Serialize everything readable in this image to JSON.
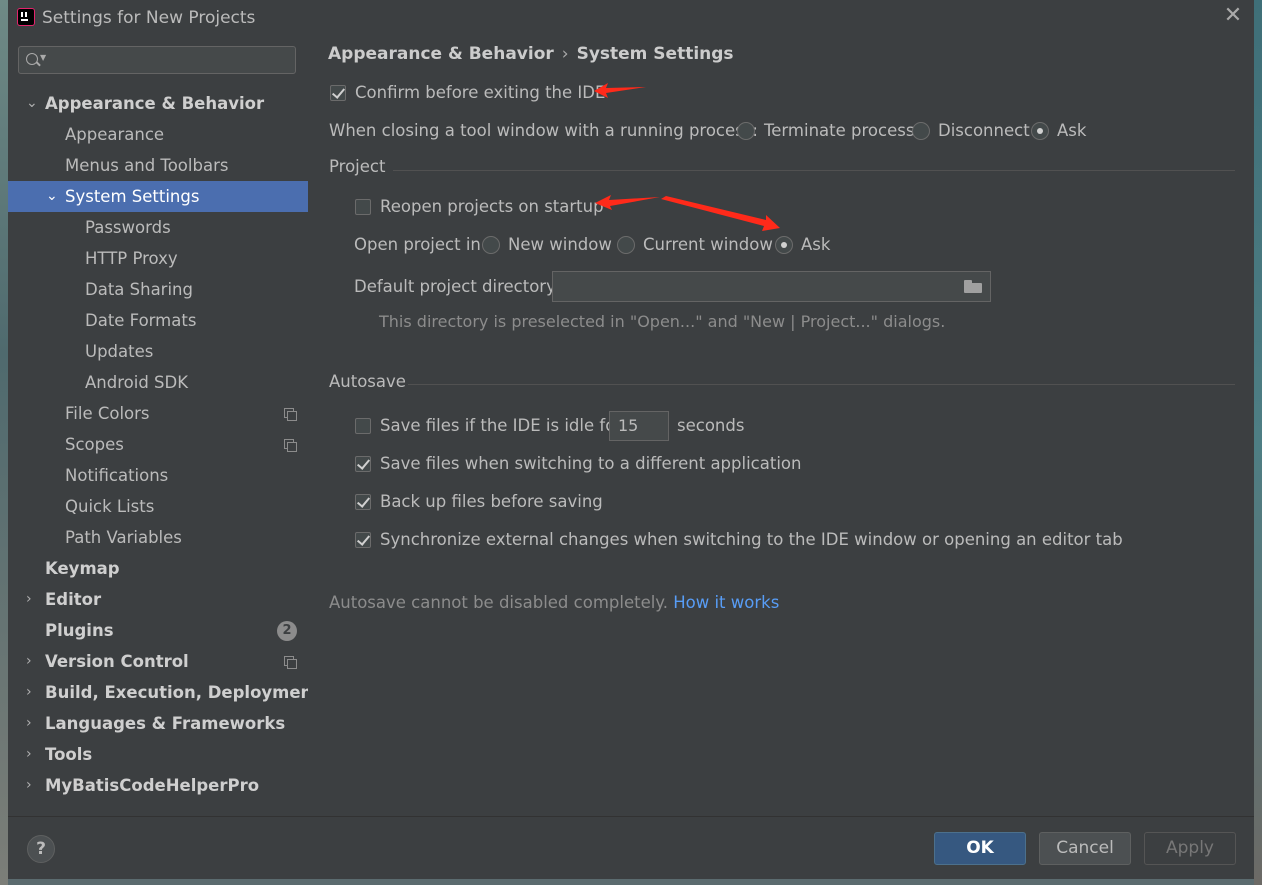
{
  "window": {
    "title": "Settings for New Projects"
  },
  "search": {
    "placeholder": ""
  },
  "sidebar": {
    "items": [
      {
        "label": "Appearance & Behavior"
      },
      {
        "label": "Appearance"
      },
      {
        "label": "Menus and Toolbars"
      },
      {
        "label": "System Settings"
      },
      {
        "label": "Passwords"
      },
      {
        "label": "HTTP Proxy"
      },
      {
        "label": "Data Sharing"
      },
      {
        "label": "Date Formats"
      },
      {
        "label": "Updates"
      },
      {
        "label": "Android SDK"
      },
      {
        "label": "File Colors"
      },
      {
        "label": "Scopes"
      },
      {
        "label": "Notifications"
      },
      {
        "label": "Quick Lists"
      },
      {
        "label": "Path Variables"
      },
      {
        "label": "Keymap"
      },
      {
        "label": "Editor"
      },
      {
        "label": "Plugins",
        "badge": "2"
      },
      {
        "label": "Version Control"
      },
      {
        "label": "Build, Execution, Deployment"
      },
      {
        "label": "Languages & Frameworks"
      },
      {
        "label": "Tools"
      },
      {
        "label": "MyBatisCodeHelperPro"
      }
    ]
  },
  "breadcrumb": {
    "parent": "Appearance & Behavior",
    "sep": "›",
    "current": "System Settings"
  },
  "general": {
    "confirm_exit": {
      "label": "Confirm before exiting the IDE",
      "checked": true
    },
    "closing_tool_window": {
      "label": "When closing a tool window with a running process:",
      "options": [
        "Terminate process",
        "Disconnect",
        "Ask"
      ],
      "selected": "Ask"
    }
  },
  "project": {
    "title": "Project",
    "reopen": {
      "label": "Reopen projects on startup",
      "checked": false
    },
    "open_in": {
      "label": "Open project in",
      "options": [
        "New window",
        "Current window",
        "Ask"
      ],
      "selected": "Ask"
    },
    "default_dir": {
      "label": "Default project directory:",
      "value": ""
    },
    "hint": "This directory is preselected in \"Open...\" and \"New | Project...\" dialogs."
  },
  "autosave": {
    "title": "Autosave",
    "idle": {
      "label": "Save files if the IDE is idle for",
      "value": "15",
      "unit": "seconds",
      "checked": false
    },
    "switching": {
      "label": "Save files when switching to a different application",
      "checked": true
    },
    "backup": {
      "label": "Back up files before saving",
      "checked": true
    },
    "sync": {
      "label": "Synchronize external changes when switching to the IDE window or opening an editor tab",
      "checked": true
    },
    "note": "Autosave cannot be disabled completely.",
    "link": "How it works"
  },
  "footer": {
    "help": "?",
    "ok": "OK",
    "cancel": "Cancel",
    "apply": "Apply"
  },
  "colors": {
    "accent": "#4b6eaf",
    "ok_button": "#365880",
    "link": "#589df6",
    "annotation": "#ff2a1a"
  }
}
